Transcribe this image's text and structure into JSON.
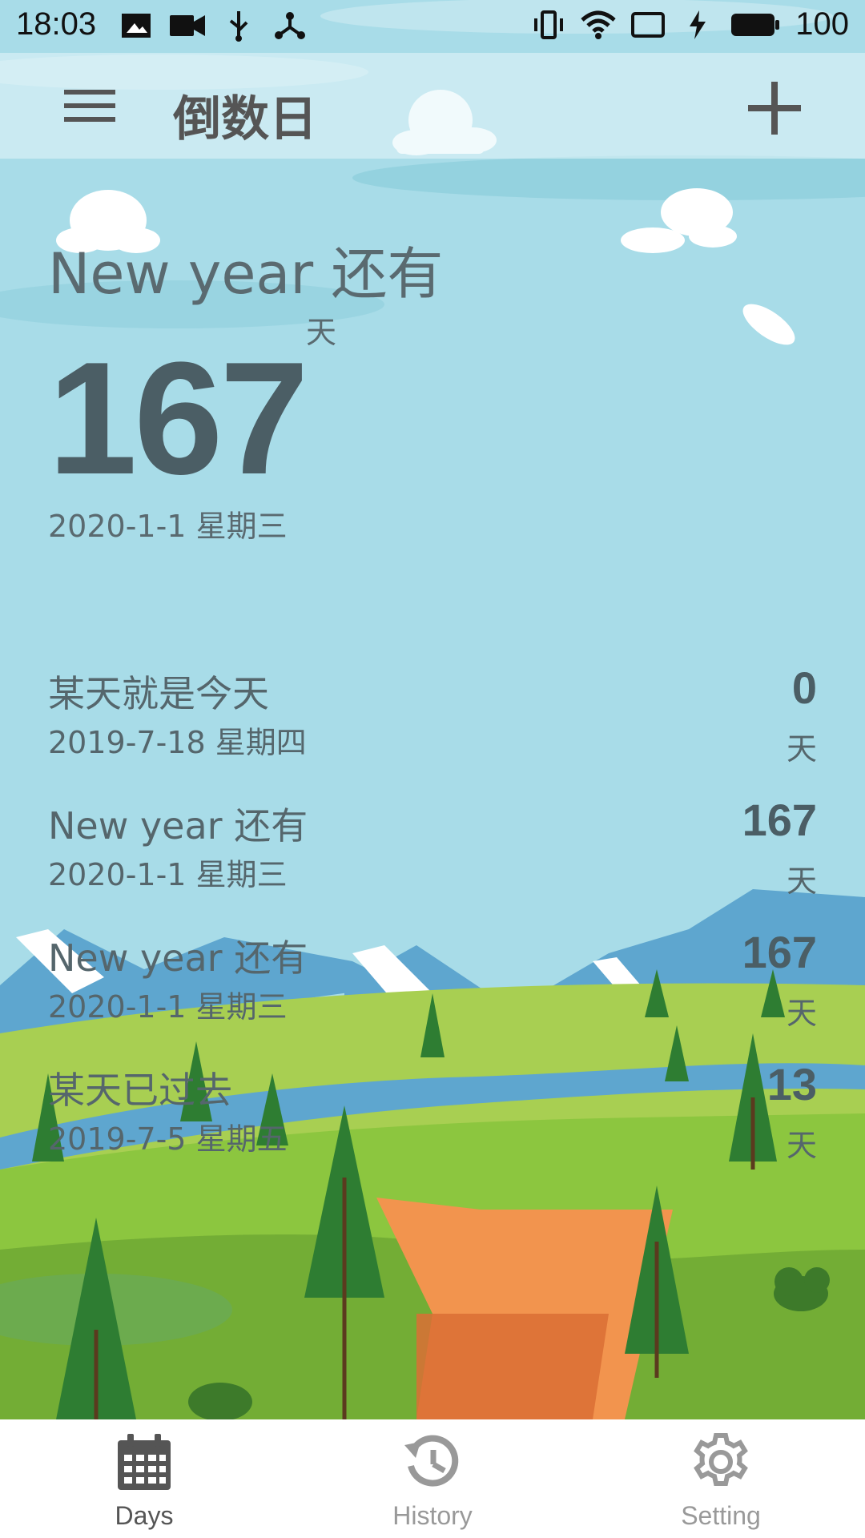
{
  "status_bar": {
    "time": "18:03",
    "battery": "100",
    "left_icons": [
      "image-icon",
      "video-icon",
      "usb-icon",
      "share-icon"
    ],
    "right_icons": [
      "vibrate-icon",
      "wifi-icon",
      "nfc-card-icon",
      "charging-icon",
      "battery-icon"
    ]
  },
  "app_bar": {
    "title": "倒数日"
  },
  "hero": {
    "title": "New year 还有",
    "count": "167",
    "unit": "天",
    "date": "2020-1-1 星期三"
  },
  "events": [
    {
      "title": "某天就是今天",
      "date": "2019-7-18 星期四",
      "count": "0",
      "unit": "天"
    },
    {
      "title": "New year 还有",
      "date": "2020-1-1 星期三",
      "count": "167",
      "unit": "天"
    },
    {
      "title": "New year 还有",
      "date": "2020-1-1 星期三",
      "count": "167",
      "unit": "天"
    },
    {
      "title": "某天已过去",
      "date": "2019-7-5 星期五",
      "count": "13",
      "unit": "天"
    }
  ],
  "bottom_nav": {
    "items": [
      {
        "label": "Days",
        "icon": "calendar-icon",
        "active": true
      },
      {
        "label": "History",
        "icon": "history-icon",
        "active": false
      },
      {
        "label": "Setting",
        "icon": "gear-icon",
        "active": false
      }
    ]
  },
  "colors": {
    "sky": "#a8dce8",
    "text_primary": "#4b5e65",
    "text_secondary": "#5a6a70",
    "nav_inactive": "#999999",
    "nav_active": "#555555"
  }
}
